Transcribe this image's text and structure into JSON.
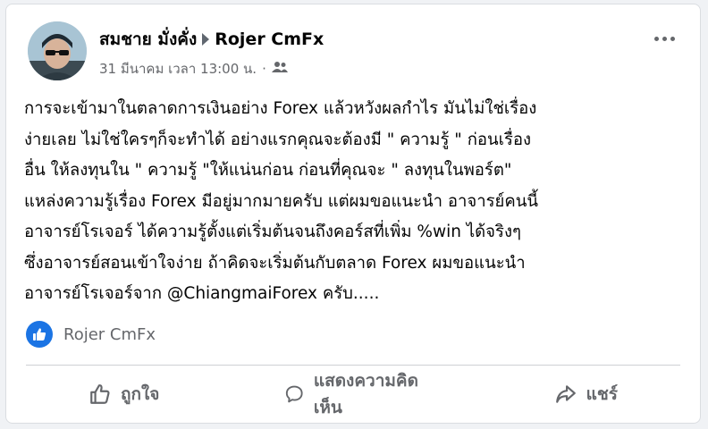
{
  "post": {
    "author": "สมชาย มั่งคั่ง",
    "page": "Rojer CmFx",
    "timestamp": "31 มีนาคม เวลา 13:00 น.",
    "separator": "·",
    "audience_icon": "friends-icon",
    "text_lines": [
      "การจะเข้ามาในตลาดการเงินอย่าง Forex แล้วหวังผลกำไร มันไม่ใช่เรื่อง",
      "ง่ายเลย ไม่ใช่ใครๆก็จะทำได้ อย่างแรกคุณจะต้องมี \" ความรู้ \" ก่อนเรื่อง",
      "อื่น ให้ลงทุนใน \" ความรู้ \"ให้แน่นก่อน ก่อนที่คุณจะ \" ลงทุนในพอร์ต\"",
      "แหล่งความรู้เรื่อง Forex มีอยู่มากมายครับ  แต่ผมขอแนะนำ อาจารย์คนนี้",
      "อาจารย์โรเจอร์  ได้ความรู้ตั้งแต่เริ่มต้นจนถึงคอร์สที่เพิ่ม %win ได้จริงๆ",
      "ซึ่งอาจารย์สอนเข้าใจง่าย  ถ้าคิดจะเริ่มต้นกับตลาด Forex  ผมขอแนะนำ",
      "อาจารย์โรเจอร์จาก  @ChiangmaiForex   ครับ....."
    ],
    "reactions": {
      "icon": "like-icon",
      "names": "Rojer CmFx"
    }
  },
  "actions": {
    "like": "ถูกใจ",
    "comment": "แสดงความคิดเห็น",
    "share": "แชร์"
  },
  "colors": {
    "accent": "#1b74e4",
    "secondary_text": "#65676b",
    "primary_text": "#050505"
  }
}
